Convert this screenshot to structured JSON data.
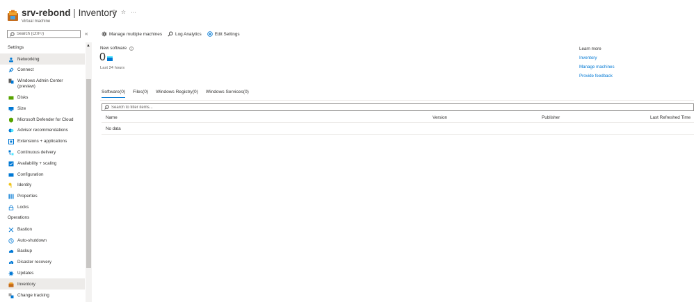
{
  "header": {
    "resource_name": "srv-rebond",
    "separator": "|",
    "page_name": "Inventory",
    "resource_type": "Virtual machine",
    "pin_icon": "pin-icon",
    "favorite_icon": "star-icon",
    "more_icon": "ellipsis-icon"
  },
  "search": {
    "placeholder": "Search (Ctrl+/)"
  },
  "collapse_glyph": "«",
  "sidebar": {
    "sections": [
      {
        "title": "Settings",
        "items": [
          {
            "label": "Networking",
            "icon": "networking-icon",
            "active": true
          },
          {
            "label": "Connect",
            "icon": "connect-icon"
          },
          {
            "label": "Windows Admin Center\n(preview)",
            "icon": "windows-admin-center-icon"
          },
          {
            "label": "Disks",
            "icon": "disks-icon"
          },
          {
            "label": "Size",
            "icon": "size-icon"
          },
          {
            "label": "Microsoft Defender for Cloud",
            "icon": "defender-icon"
          },
          {
            "label": "Advisor recommendations",
            "icon": "advisor-icon"
          },
          {
            "label": "Extensions + applications",
            "icon": "extensions-icon"
          },
          {
            "label": "Continuous delivery",
            "icon": "continuous-delivery-icon"
          },
          {
            "label": "Availability + scaling",
            "icon": "availability-icon"
          },
          {
            "label": "Configuration",
            "icon": "configuration-icon"
          },
          {
            "label": "Identity",
            "icon": "identity-icon"
          },
          {
            "label": "Properties",
            "icon": "properties-icon"
          },
          {
            "label": "Locks",
            "icon": "lock-icon"
          }
        ]
      },
      {
        "title": "Operations",
        "items": [
          {
            "label": "Bastion",
            "icon": "bastion-icon"
          },
          {
            "label": "Auto-shutdown",
            "icon": "clock-icon"
          },
          {
            "label": "Backup",
            "icon": "backup-icon"
          },
          {
            "label": "Disaster recovery",
            "icon": "disaster-recovery-icon"
          },
          {
            "label": "Updates",
            "icon": "updates-icon"
          },
          {
            "label": "Inventory",
            "icon": "inventory-icon",
            "active": true
          },
          {
            "label": "Change tracking",
            "icon": "change-tracking-icon"
          }
        ]
      }
    ]
  },
  "toolbar": {
    "manage_multiple": "Manage multiple machines",
    "log_analytics": "Log Analytics",
    "edit_settings": "Edit Settings"
  },
  "stats": {
    "label": "New software",
    "value": "0",
    "period": "Last 24 hours"
  },
  "learn_more": {
    "title": "Learn more",
    "links": [
      "Inventory",
      "Manage machines",
      "Provide feedback"
    ]
  },
  "tabs": [
    {
      "label": "Software(0)",
      "active": true
    },
    {
      "label": "Files(0)"
    },
    {
      "label": "Windows Registry(0)"
    },
    {
      "label": "Windows Services(0)"
    }
  ],
  "filter": {
    "placeholder": "Search to filter items..."
  },
  "grid": {
    "columns": [
      "Name",
      "Version",
      "Publisher",
      "Last Refreshed Time"
    ],
    "empty_text": "No data"
  },
  "colors": {
    "accent": "#0078d4",
    "active_bg": "#edebe9",
    "text": "#323130"
  }
}
